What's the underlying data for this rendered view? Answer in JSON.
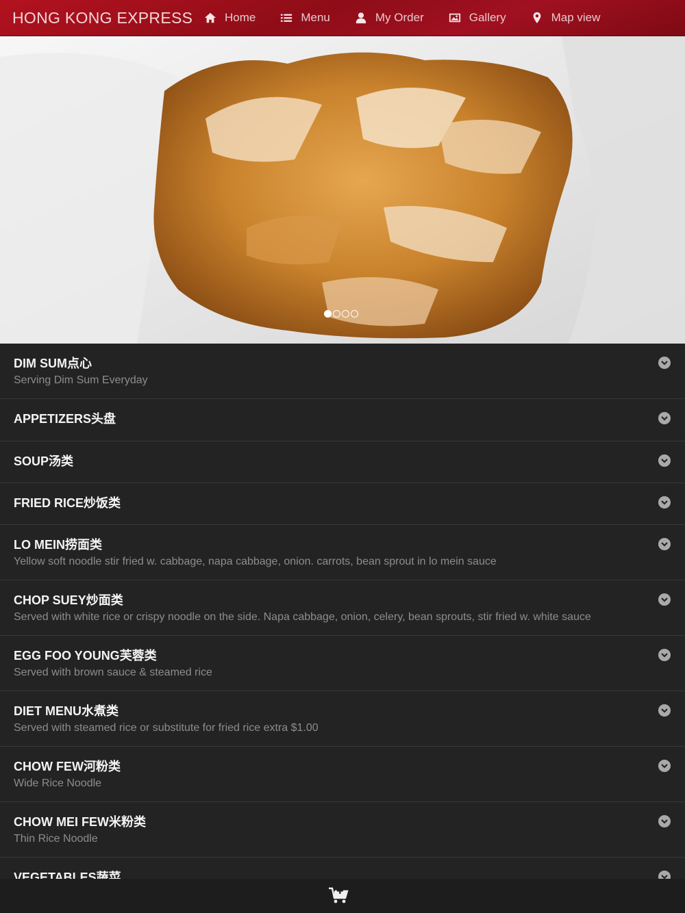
{
  "header": {
    "brand": "HONG KONG EXPRESS",
    "nav": [
      {
        "label": "Home",
        "icon": "home-icon"
      },
      {
        "label": "Menu",
        "icon": "list-icon"
      },
      {
        "label": "My Order",
        "icon": "user-icon"
      },
      {
        "label": "Gallery",
        "icon": "picture-icon"
      },
      {
        "label": "Map view",
        "icon": "map-marker-icon"
      }
    ]
  },
  "carousel": {
    "slide_count": 4,
    "active_index": 0
  },
  "categories": [
    {
      "title": "DIM SUM点心",
      "subtitle": "Serving Dim Sum Everyday"
    },
    {
      "title": "APPETIZERS头盘",
      "subtitle": ""
    },
    {
      "title": "SOUP汤类",
      "subtitle": ""
    },
    {
      "title": "FRIED RICE炒饭类",
      "subtitle": ""
    },
    {
      "title": "LO MEIN捞面类",
      "subtitle": "Yellow soft noodle stir fried w. cabbage, napa cabbage, onion. carrots, bean sprout in lo mein sauce"
    },
    {
      "title": "CHOP SUEY炒面类",
      "subtitle": "Served with white rice or crispy noodle on the side. Napa cabbage, onion, celery, bean sprouts, stir fried w. white sauce"
    },
    {
      "title": "EGG FOO YOUNG芙蓉类",
      "subtitle": "Served with brown sauce & steamed rice"
    },
    {
      "title": "DIET MENU水煮类",
      "subtitle": "Served with steamed rice or substitute for fried rice extra $1.00"
    },
    {
      "title": "CHOW FEW河粉类",
      "subtitle": "Wide Rice Noodle"
    },
    {
      "title": "CHOW MEI FEW米粉类",
      "subtitle": "Thin Rice Noodle"
    },
    {
      "title": "VEGETABLES蔬菜",
      "subtitle": ""
    }
  ],
  "bottom_bar": {
    "icon": "cart-add-icon"
  },
  "colors": {
    "navbar": "#a01020",
    "list_background": "#232323",
    "title_text": "#f4f4f4",
    "subtitle_text": "#8d8d8d"
  }
}
